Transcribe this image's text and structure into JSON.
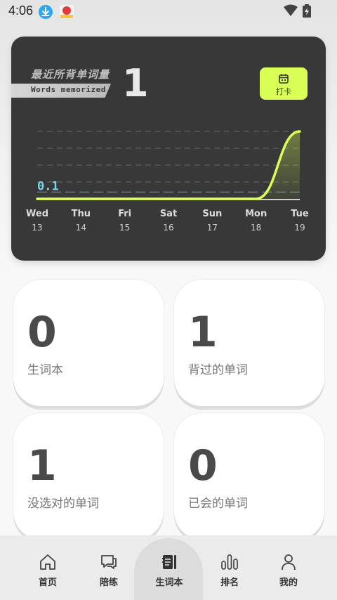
{
  "status_bar": {
    "time": "4:06",
    "icons": [
      "download-badge-icon",
      "app-notification-icon",
      "wifi-icon",
      "battery-charging-icon"
    ]
  },
  "stats_card": {
    "title": "最近所背单词量",
    "subtitle": "Words memorized",
    "count": "1",
    "checkin_label": "打卡",
    "checkin_icon": "calendar-icon",
    "accent_color": "#d9ff57"
  },
  "chart_data": {
    "type": "line",
    "categories": [
      {
        "day": "Wed",
        "date": "13"
      },
      {
        "day": "Thu",
        "date": "14"
      },
      {
        "day": "Fri",
        "date": "15"
      },
      {
        "day": "Sat",
        "date": "16"
      },
      {
        "day": "Sun",
        "date": "17"
      },
      {
        "day": "Mon",
        "date": "18"
      },
      {
        "day": "Tue",
        "date": "19"
      }
    ],
    "values": [
      0,
      0,
      0,
      0,
      0,
      0,
      1
    ],
    "reference_label": "0.1",
    "reference_value": 0.1,
    "ylim": [
      0,
      1
    ],
    "line_color": "#d9ff57",
    "reference_color": "#7ad7e8"
  },
  "tiles": [
    {
      "value": "0",
      "label": "生词本"
    },
    {
      "value": "1",
      "label": "背过的单词"
    },
    {
      "value": "1",
      "label": "没选对的单词"
    },
    {
      "value": "0",
      "label": "已会的单词"
    }
  ],
  "nav": {
    "active": "生词本",
    "items": [
      {
        "label": "首页",
        "icon": "home-icon"
      },
      {
        "label": "陪练",
        "icon": "chat-icon"
      },
      {
        "label": "生词本",
        "icon": "notebook-icon"
      },
      {
        "label": "排名",
        "icon": "bar-chart-icon"
      },
      {
        "label": "我的",
        "icon": "profile-icon"
      }
    ]
  }
}
